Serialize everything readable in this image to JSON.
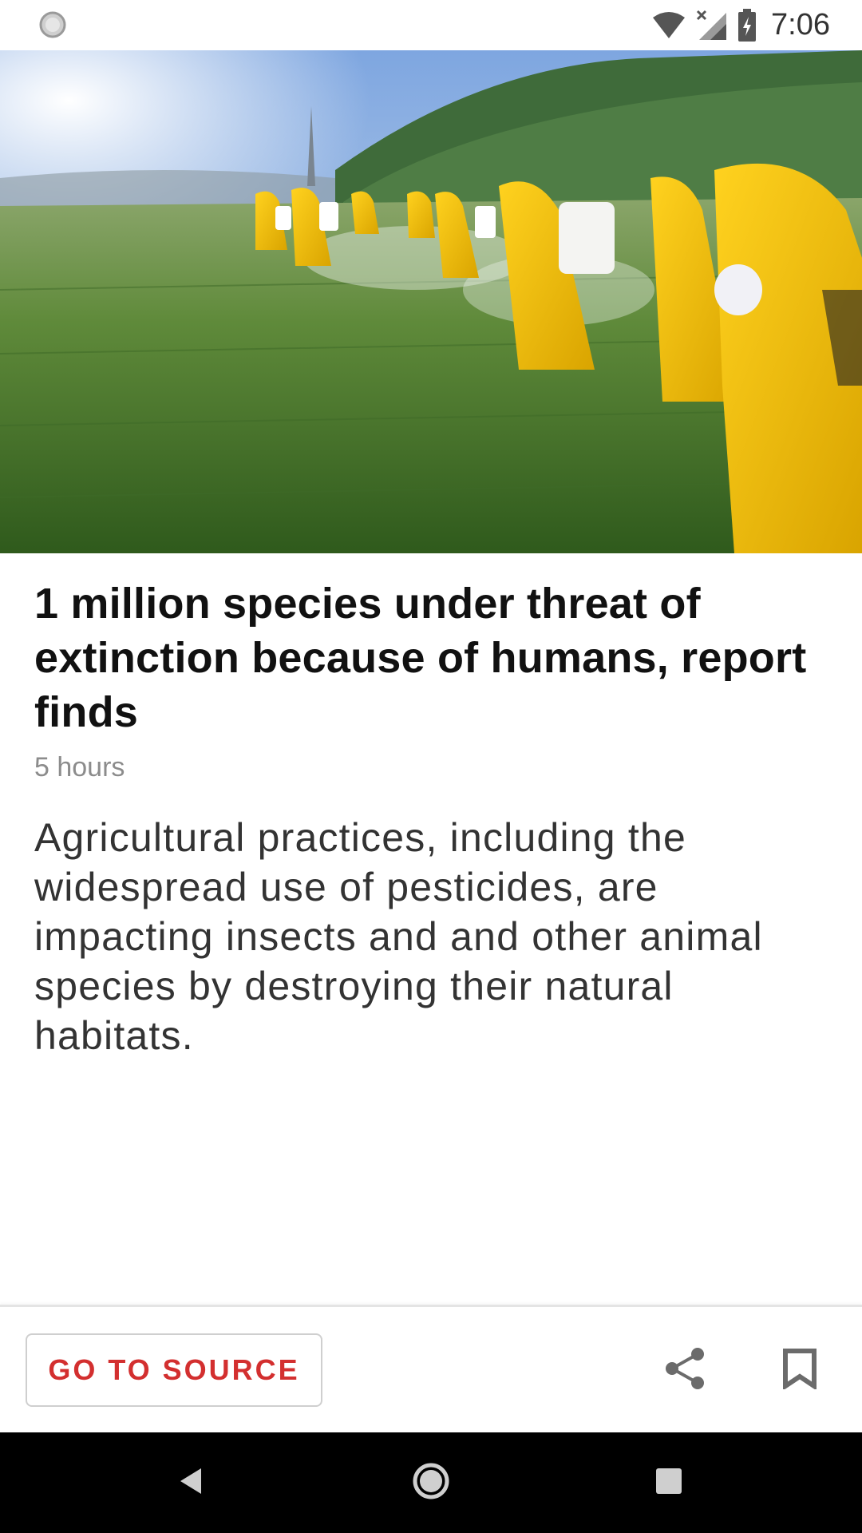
{
  "status_bar": {
    "time": "7:06",
    "icons": [
      "loading-indicator-icon",
      "wifi-icon",
      "cellular-no-signal-icon",
      "battery-charging-icon"
    ]
  },
  "hero_image": {
    "description_icon": "photo-workers-spraying-pesticides"
  },
  "article": {
    "headline": "1 million species under threat of extinction because of humans, report finds",
    "timestamp": "5 hours",
    "summary": "Agricultural practices, including the widespread use of pesticides, are impacting insects and and other animal species by destroying their natural habitats."
  },
  "actions": {
    "source_label": "GO TO SOURCE",
    "share_icon": "share-icon",
    "bookmark_icon": "bookmark-icon"
  },
  "nav": {
    "icons": [
      "back-icon",
      "home-icon",
      "recents-icon"
    ]
  },
  "colors": {
    "accent": "#d32f2f",
    "text_primary": "#111111",
    "text_secondary": "#8c8c8c",
    "nav_background": "#000000"
  }
}
